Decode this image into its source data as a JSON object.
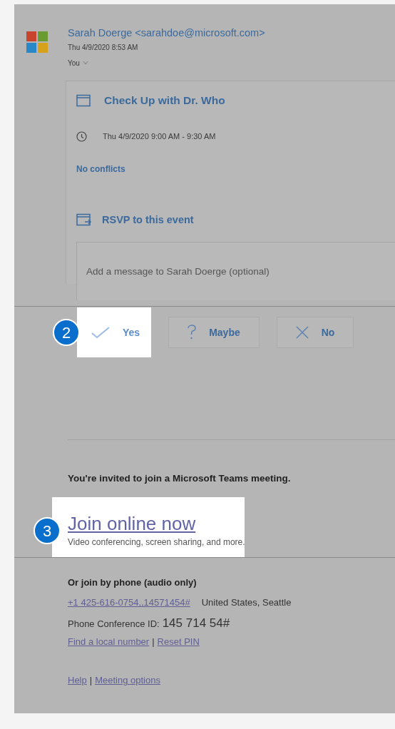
{
  "sender": {
    "name": "Sarah Doerge <sarahdoe@microsoft.com>",
    "time": "Thu 4/9/2020 8:53 AM",
    "recipients": "You"
  },
  "event": {
    "title": "Check Up with Dr. Who",
    "time": "Thu 4/9/2020 9:00 AM - 9:30 AM",
    "conflicts": "No conflicts"
  },
  "rsvp": {
    "heading": "RSVP to this event",
    "message": {
      "placeholder": "Add a message to Sarah Doerge (optional)"
    },
    "responses": [
      {
        "kind": "yes",
        "label": "Yes",
        "highlighted": true,
        "callout": "2"
      },
      {
        "kind": "maybe",
        "label": "Maybe",
        "highlighted": false
      },
      {
        "kind": "no",
        "label": "No",
        "highlighted": false
      }
    ]
  },
  "meeting": {
    "invite": "You're invited to join a Microsoft Teams meeting.",
    "join": {
      "link": "Join online now",
      "description": "Video conferencing, screen sharing, and more.",
      "highlighted": true,
      "callout": "3"
    },
    "phone": {
      "heading": "Or join by phone (audio only)",
      "number": "+1 425-616-0754,,14571454#",
      "location": "United States, Seattle",
      "conference_label": "Phone Conference ID:",
      "conference_id": "145 714 54#",
      "links": [
        "Find a local number",
        "Reset PIN"
      ],
      "separator": "|"
    },
    "footer": {
      "links": [
        "Help",
        "Meeting options"
      ],
      "separator": "|"
    }
  }
}
